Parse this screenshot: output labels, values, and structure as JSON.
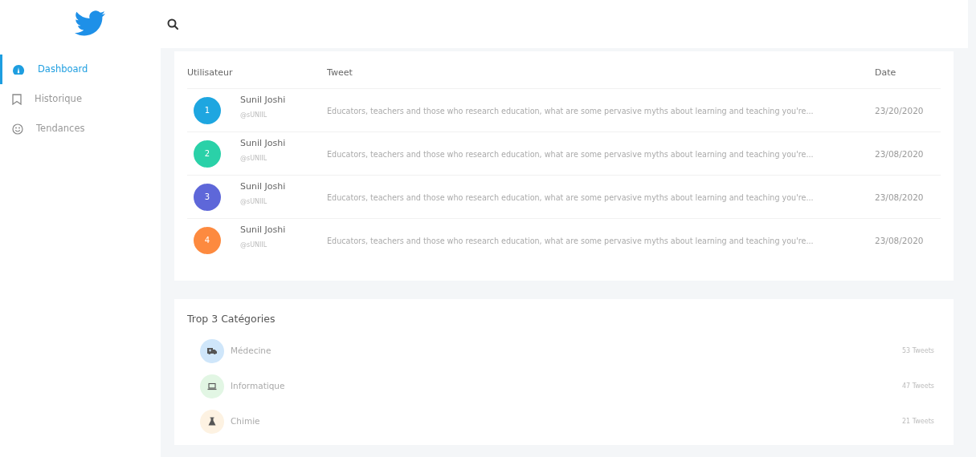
{
  "sidebar": {
    "items": [
      {
        "label": "Dashboard",
        "selected": true
      },
      {
        "label": "Historique",
        "selected": false
      },
      {
        "label": "Tendances",
        "selected": false
      }
    ]
  },
  "table": {
    "columns": [
      "Utilisateur",
      "Tweet",
      "Date"
    ],
    "rows": [
      {
        "number": "1",
        "color": "#1ea6e0",
        "name": "Sunil Joshi",
        "handle": "@sUNIIL",
        "tweet": "Educators, teachers and those who research education, what are some pervasive myths about learning and teaching you're...",
        "date": "23/20/2020"
      },
      {
        "number": "2",
        "color": "#2ad1a8",
        "name": "Sunil Joshi",
        "handle": "@sUNIIL",
        "tweet": "Educators, teachers and those who research education, what are some pervasive myths about learning and teaching you're...",
        "date": "23/08/2020"
      },
      {
        "number": "3",
        "color": "#5e67d9",
        "name": "Sunil Joshi",
        "handle": "@sUNIIL",
        "tweet": "Educators, teachers and those who research education, what are some pervasive myths about learning and teaching you're...",
        "date": "23/08/2020"
      },
      {
        "number": "4",
        "color": "#fd8a3f",
        "name": "Sunil Joshi",
        "handle": "@sUNIIL",
        "tweet": "Educators, teachers and those who research education, what are some pervasive myths about learning and teaching you're...",
        "date": "23/08/2020"
      }
    ]
  },
  "categories": {
    "title": "Trop 3 Catégories",
    "items": [
      {
        "label": "Médecine",
        "color": "#cfe6fa",
        "count": "53 Tweets"
      },
      {
        "label": "Informatique",
        "color": "#e2f6e4",
        "count": "47 Tweets"
      },
      {
        "label": "Chimie",
        "color": "#fdf2e2",
        "count": "21 Tweets"
      }
    ]
  }
}
